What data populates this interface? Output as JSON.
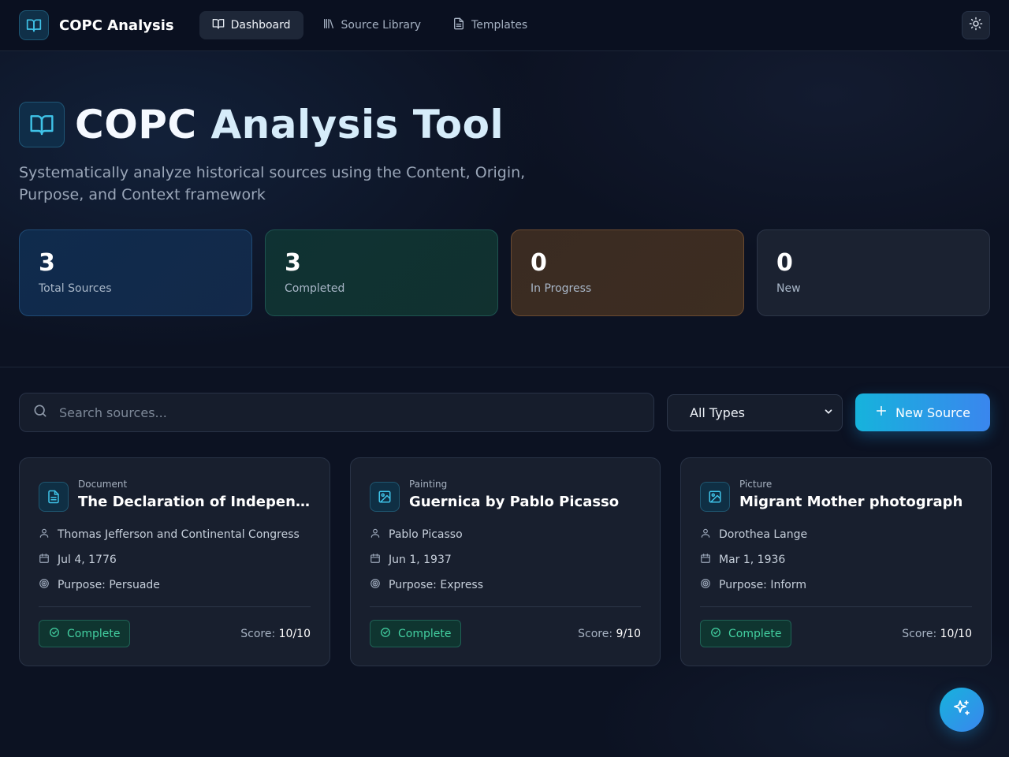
{
  "app": {
    "brand": "COPC Analysis",
    "nav": [
      {
        "label": "Dashboard",
        "icon": "book-open-icon",
        "active": true
      },
      {
        "label": "Source Library",
        "icon": "library-icon",
        "active": false
      },
      {
        "label": "Templates",
        "icon": "file-text-icon",
        "active": false
      }
    ],
    "theme_toggle_icon": "sun-icon"
  },
  "hero": {
    "title_part1": "COPC",
    "title_part2": "Analysis Tool",
    "subtitle": "Systematically analyze historical sources using the Content, Origin, Purpose, and Context framework"
  },
  "stats": [
    {
      "value": "3",
      "label": "Total Sources",
      "color": "#0f2b4c"
    },
    {
      "value": "3",
      "label": "Completed",
      "color": "#0f3233"
    },
    {
      "value": "0",
      "label": "In Progress",
      "color": "#3a2b22"
    },
    {
      "value": "0",
      "label": "New",
      "color": "#1b2231"
    }
  ],
  "search": {
    "placeholder": "Search sources..."
  },
  "filter": {
    "selected": "All Types"
  },
  "new_source_label": "New Source",
  "sources": [
    {
      "type": "Document",
      "type_icon": "file-text-icon",
      "title": "The Declaration of Independence",
      "author": "Thomas Jefferson and Continental Congress",
      "date": "Jul 4, 1776",
      "purpose": "Purpose: Persuade",
      "status": "Complete",
      "score_label": "Score:",
      "score": "10/10"
    },
    {
      "type": "Painting",
      "type_icon": "image-icon",
      "title": "Guernica by Pablo Picasso",
      "author": "Pablo Picasso",
      "date": "Jun 1, 1937",
      "purpose": "Purpose: Express",
      "status": "Complete",
      "score_label": "Score:",
      "score": "9/10"
    },
    {
      "type": "Picture",
      "type_icon": "image-icon",
      "title": "Migrant Mother photograph",
      "author": "Dorothea Lange",
      "date": "Mar 1, 1936",
      "purpose": "Purpose: Inform",
      "status": "Complete",
      "score_label": "Score:",
      "score": "10/10"
    }
  ],
  "fab_icon": "sparkles-icon",
  "colors": {
    "accent": "#16b3dc",
    "success": "#43d0a1",
    "background": "#0c1222"
  }
}
